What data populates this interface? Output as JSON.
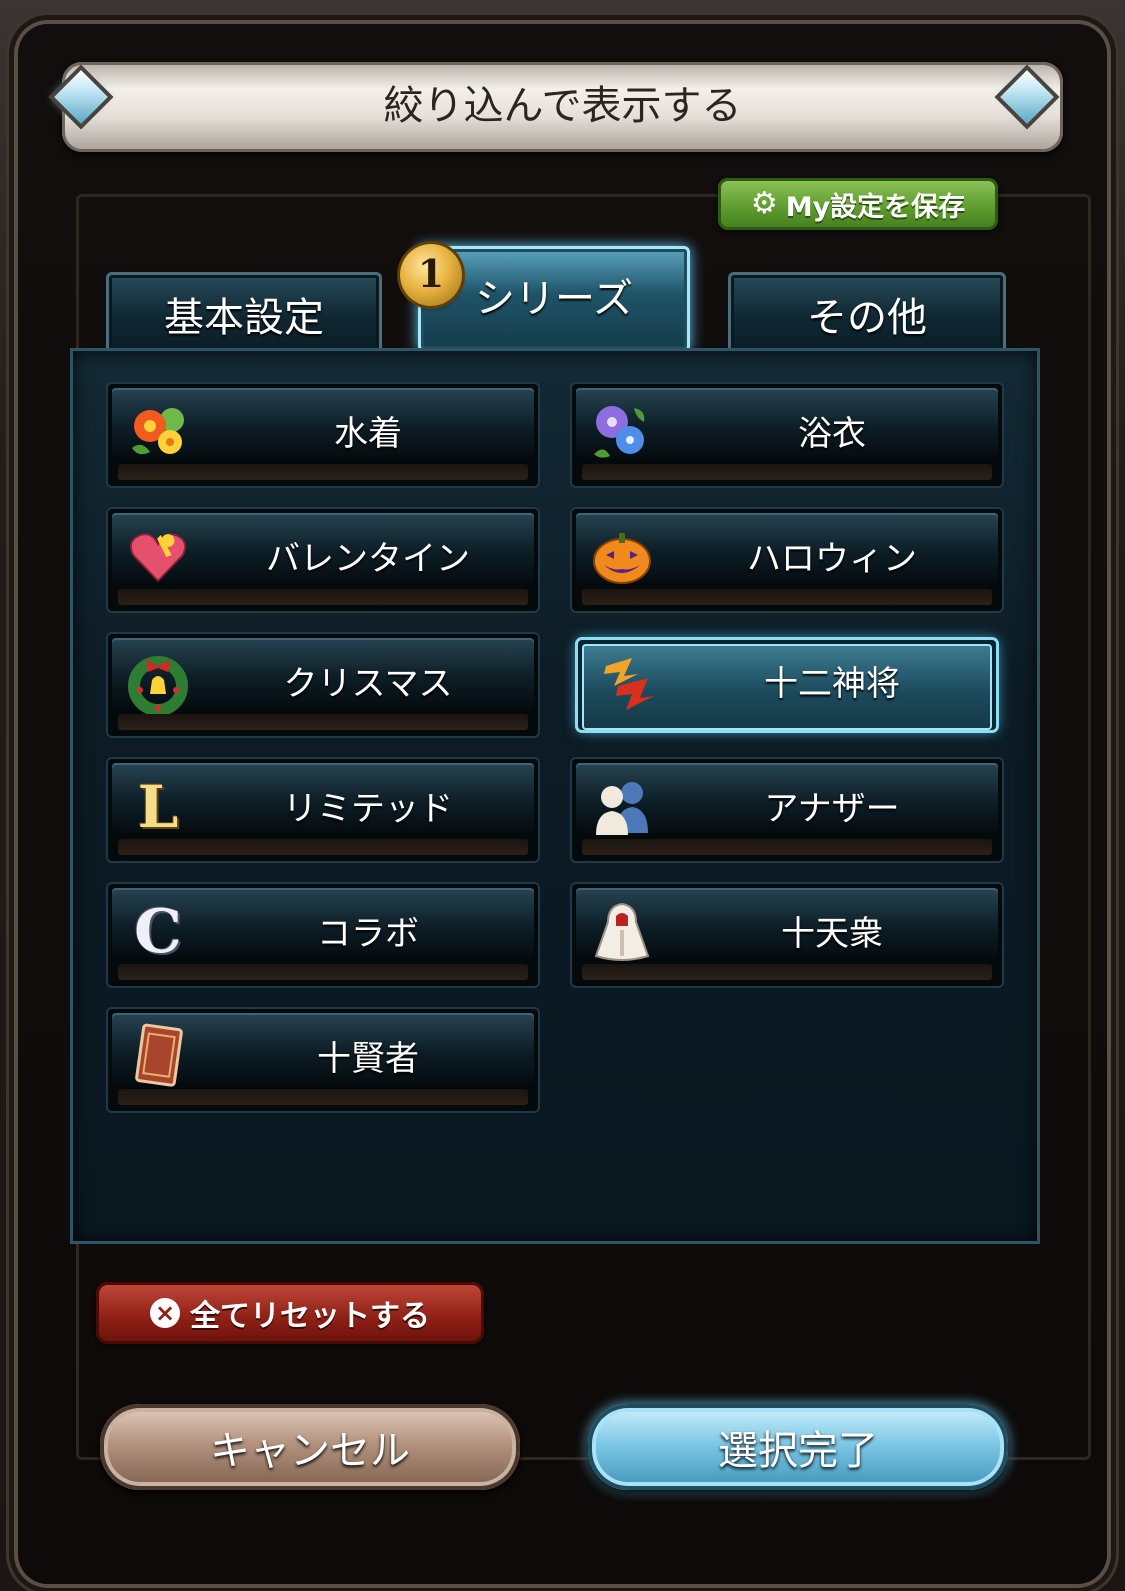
{
  "dialog": {
    "title": "絞り込んで表示する",
    "save_label": "My設定を保存",
    "reset_label": "全てリセットする",
    "cancel_label": "キャンセル",
    "confirm_label": "選択完了"
  },
  "tabs": [
    {
      "label": "基本設定",
      "active": false
    },
    {
      "label": "シリーズ",
      "active": true,
      "badge": "1"
    },
    {
      "label": "その他",
      "active": false
    }
  ],
  "series_options": [
    {
      "label": "水着",
      "icon": "flowers-icon",
      "selected": false
    },
    {
      "label": "浴衣",
      "icon": "morning-glory-icon",
      "selected": false
    },
    {
      "label": "バレンタイン",
      "icon": "heart-gift-icon",
      "selected": false
    },
    {
      "label": "ハロウィン",
      "icon": "pumpkin-icon",
      "selected": false
    },
    {
      "label": "クリスマス",
      "icon": "wreath-icon",
      "selected": false
    },
    {
      "label": "十二神将",
      "icon": "zodiac-emblem-icon",
      "selected": true
    },
    {
      "label": "リミテッド",
      "icon": "letter-l-icon",
      "glyph": "L",
      "selected": false
    },
    {
      "label": "アナザー",
      "icon": "two-people-icon",
      "selected": false
    },
    {
      "label": "コラボ",
      "icon": "letter-c-icon",
      "glyph": "C",
      "selected": false
    },
    {
      "label": "十天衆",
      "icon": "hooded-figure-icon",
      "selected": false
    },
    {
      "label": "十賢者",
      "icon": "card-icon",
      "selected": false
    }
  ],
  "colors": {
    "accent_selected": "#8fdcf5",
    "save_button": "#5c9a2d",
    "reset_button": "#8d1f15",
    "badge": "#e8b340"
  }
}
